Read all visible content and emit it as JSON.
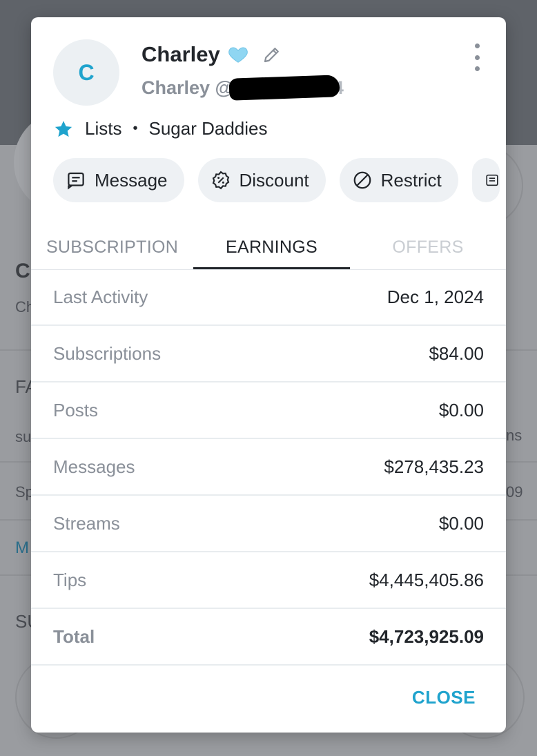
{
  "background": {
    "initial": "C",
    "subname": "Ch",
    "section_fan": "FA",
    "sub_text": "su",
    "sp_text": "Sp",
    "more_link": "M",
    "section_su": "SU",
    "right_ns": "ns",
    "right_09": "09"
  },
  "profile": {
    "avatar_initial": "C",
    "name": "Charley",
    "handle": "Charley @",
    "handle_suffix": "74",
    "lists_label": "Lists",
    "list_name": "Sugar Daddies"
  },
  "actions": {
    "message": "Message",
    "discount": "Discount",
    "restrict": "Restrict"
  },
  "tabs": [
    {
      "label": "SUBSCRIPTION"
    },
    {
      "label": "EARNINGS"
    },
    {
      "label": "OFFERS"
    }
  ],
  "earnings": [
    {
      "label": "Last Activity",
      "value": "Dec 1, 2024"
    },
    {
      "label": "Subscriptions",
      "value": "$84.00"
    },
    {
      "label": "Posts",
      "value": "$0.00"
    },
    {
      "label": "Messages",
      "value": "$278,435.23"
    },
    {
      "label": "Streams",
      "value": "$0.00"
    },
    {
      "label": "Tips",
      "value": "$4,445,405.86"
    },
    {
      "label": "Total",
      "value": "$4,723,925.09"
    }
  ],
  "close_label": "CLOSE",
  "colors": {
    "accent": "#1fa3cd",
    "heart": "#8fd6f2",
    "star": "#1fa3cd",
    "text_primary": "#22262b",
    "text_muted": "#8a9099"
  },
  "icons": {
    "heart": "heart-icon",
    "pencil": "pencil-icon",
    "more": "more-vertical-icon",
    "star": "star-icon",
    "message": "message-icon",
    "discount": "discount-icon",
    "restrict": "restrict-icon"
  }
}
